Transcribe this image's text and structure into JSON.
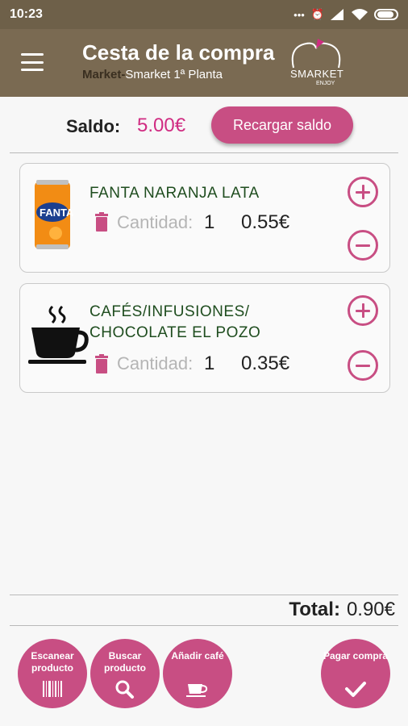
{
  "status_bar": {
    "time": "10:23",
    "icons": [
      "more-dots-icon",
      "alarm-icon",
      "signal-icon",
      "wifi-icon",
      "battery-icon"
    ]
  },
  "app_bar": {
    "title": "Cesta de la compra",
    "subtitle_bold": "Market-",
    "subtitle_rest": "Smarket 1ª Planta",
    "logo_text": "SMARKET",
    "logo_sub": "ENJOY"
  },
  "saldo": {
    "label": "Saldo:",
    "value": "5.00€",
    "recharge_button": "Recargar saldo"
  },
  "products": [
    {
      "name_lines": [
        "FANTA NARANJA LATA"
      ],
      "qty_label": "Cantidad:",
      "qty": "1",
      "price": "0.55€",
      "image": "fanta-can"
    },
    {
      "name_lines": [
        "CAFÉS/INFUSIONES/",
        "CHOCOLATE EL POZO"
      ],
      "qty_label": "Cantidad:",
      "qty": "1",
      "price": "0.35€",
      "image": "coffee-cup"
    }
  ],
  "total": {
    "label": "Total:",
    "value": "0.90€"
  },
  "bottom_actions": [
    {
      "label": "Escanear producto",
      "icon": "barcode-icon"
    },
    {
      "label": "Buscar producto",
      "icon": "search-icon"
    },
    {
      "label": "Añadir café",
      "icon": "coffee-icon"
    },
    {
      "label": "Pagar compra",
      "icon": "check-icon"
    }
  ],
  "colors": {
    "app_bar": "#7a6a52",
    "status_bar": "#6e6049",
    "accent": "#c84e83",
    "saldo_value": "#d02c82",
    "product_name": "#1f4d1f"
  }
}
